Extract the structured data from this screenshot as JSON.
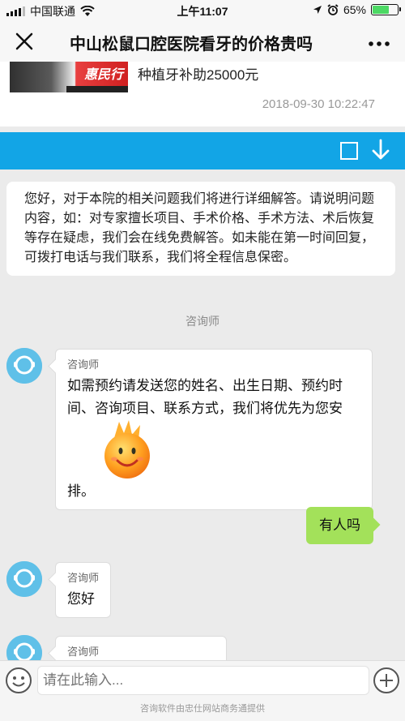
{
  "status_bar": {
    "carrier": "中国联通",
    "time": "上午11:07",
    "battery": "65%",
    "battery_level": 0.65
  },
  "nav": {
    "title": "中山松鼠口腔医院看牙的价格贵吗",
    "close_icon": "close-icon",
    "more_icon": "more-icon"
  },
  "article": {
    "thumb_text": "惠民行",
    "headline": "种植牙补助25000元",
    "date": "2018-09-30 10:22:47"
  },
  "toolbar": {
    "color": "#12a5e6"
  },
  "chat": {
    "notice": "您好，对于本院的相关问题我们将进行详细解答。请说明问题内容，如：对专家擅长项目、手术价格、手术方法、术后恢复等存在疑虑，我们会在线免费解答。如未能在第一时间回复，可拨打电话与我们联系，我们将全程信息保密。",
    "system_label": "咨询师",
    "messages": [
      {
        "sender": "咨询师",
        "text_1": "如需预约请发送您的姓名、出生日期、预约时间、咨询项目、联系方式，我们将优先为您安",
        "text_2": "排。"
      },
      {
        "sender": "me",
        "text": "有人吗"
      },
      {
        "sender": "咨询师",
        "text": "您好"
      },
      {
        "sender": "咨询师",
        "text": ""
      }
    ]
  },
  "input": {
    "placeholder": "请在此输入..."
  },
  "footer": {
    "text": "咨询软件由忠仕网站商务通提供"
  }
}
